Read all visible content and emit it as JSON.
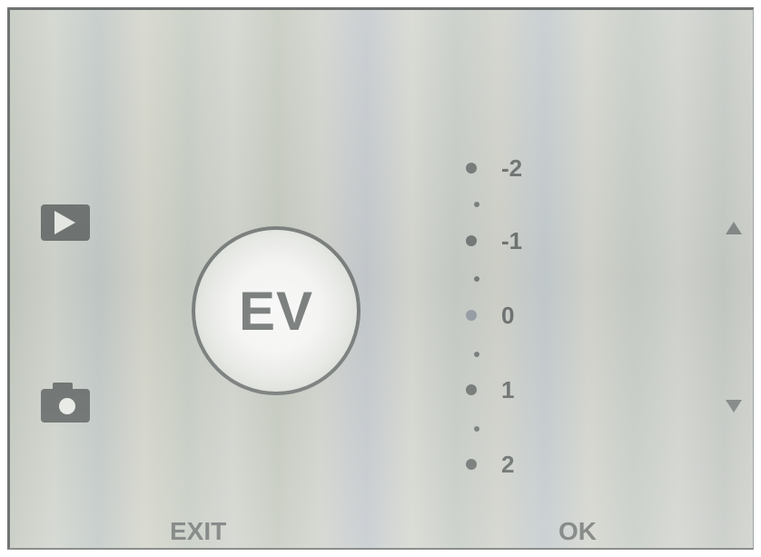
{
  "ev_badge": {
    "label": "EV"
  },
  "ev_scale": {
    "options": [
      "-2",
      "-1",
      "0",
      "1",
      "2"
    ],
    "selected": "0"
  },
  "soft_keys": {
    "exit_label": "EXIT",
    "ok_label": "OK"
  },
  "icons": {
    "playback": "play-icon",
    "capture": "camera-icon",
    "up": "arrow-up-icon",
    "down": "arrow-down-icon"
  },
  "colors": {
    "screen_background": "#cfd3cc",
    "icon_fill": "#6f7472",
    "text": "#7c807e"
  }
}
